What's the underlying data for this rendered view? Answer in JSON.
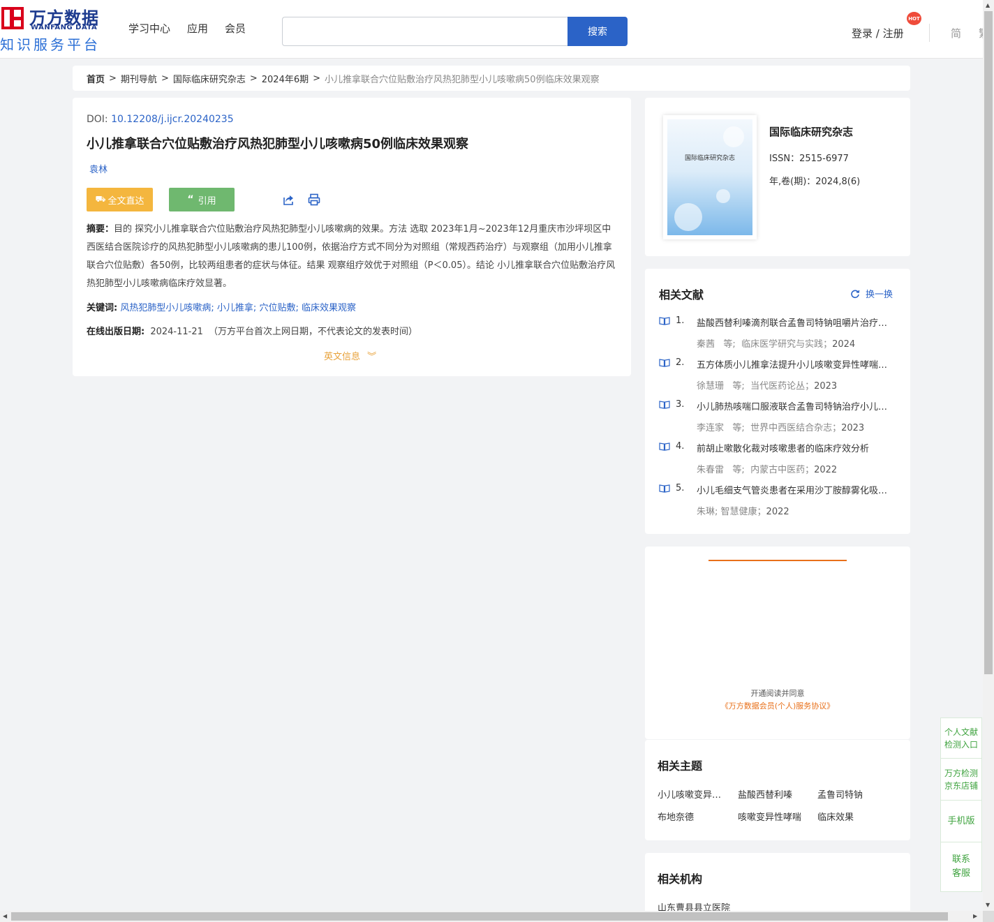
{
  "header": {
    "logo_cn": "万方数据",
    "logo_en": "WANFANG DATA",
    "logo_sub": "知识服务平台",
    "nav": [
      "学习中心",
      "应用",
      "会员"
    ],
    "search_placeholder": "",
    "search_button": "搜索",
    "login": "登录 / 注册",
    "hot_badge": "HOT",
    "lang": "简",
    "lang2": "繁"
  },
  "breadcrumb": {
    "home": "首页",
    "items": [
      "期刊导航",
      "国际临床研究杂志",
      "2024年6期"
    ],
    "current": "小儿推拿联合穴位贴敷治疗风热犯肺型小儿咳嗽病50例临床效果观察",
    "sep": ">"
  },
  "article": {
    "doi_label": "DOI:",
    "doi": "10.12208/j.ijcr.20240235",
    "title": "小儿推拿联合穴位贴敷治疗风热犯肺型小儿咳嗽病50例临床效果观察",
    "author": "袁林",
    "btn_full": "全文直达",
    "btn_cite": "引用",
    "abstract_label": "摘要：",
    "abstract": "目的 探究小儿推拿联合穴位贴敷治疗风热犯肺型小儿咳嗽病的效果。方法 选取 2023年1月~2023年12月重庆市沙坪坝区中西医结合医院诊疗的风热犯肺型小儿咳嗽病的患儿100例，依据治疗方式不同分为对照组（常规西药治疗）与观察组（加用小儿推拿联合穴位贴敷）各50例，比较两组患者的症状与体征。结果 观察组疗效优于对照组（P＜0.05）。结论 小儿推拿联合穴位贴敷治疗风热犯肺型小儿咳嗽病临床疗效显著。",
    "keywords_label": "关键词:",
    "keywords": [
      "风热犯肺型小儿咳嗽病",
      "小儿推拿",
      "穴位贴敷",
      "临床效果观察"
    ],
    "pub_label": "在线出版日期:",
    "pub_date": "2024-11-21",
    "pub_note": "（万方平台首次上网日期，不代表论文的发表时间）",
    "en_info": "英文信息"
  },
  "journal": {
    "cover_title": "国际临床研究杂志",
    "name": "国际临床研究杂志",
    "issn": "ISSN：2515-6977",
    "vol": "年,卷(期)：2024,8(6)"
  },
  "related": {
    "title": "相关文献",
    "refresh": "换一换",
    "items": [
      {
        "num": "1.",
        "title": "盐酸西替利嗪滴剂联合孟鲁司特钠咀嚼片治疗小儿咳嗽变异性哮喘的效果",
        "authors": "秦茜",
        "etc": "等;",
        "source": "临床医学研究与实践；",
        "year": "2024"
      },
      {
        "num": "2.",
        "title": "五方体质小儿推拿法提升小儿咳嗽变异性哮喘疗效的研究",
        "authors": "徐慧珊",
        "etc": "等;",
        "source": "当代医药论丛；",
        "year": "2023"
      },
      {
        "num": "3.",
        "title": "小儿肺热咳喘口服液联合孟鲁司特钠治疗小儿支原体肺炎的效果",
        "authors": "李连家",
        "etc": "等;",
        "source": "世界中西医结合杂志；",
        "year": "2023"
      },
      {
        "num": "4.",
        "title": "前胡止嗽散化裁对咳嗽患者的临床疗效分析",
        "authors": "朱春雷",
        "etc": "等;",
        "source": "内蒙古中医药；",
        "year": "2022"
      },
      {
        "num": "5.",
        "title": "小儿毛细支气管炎患者在采用沙丁胺醇雾化吸入治疗中的效果",
        "authors": "朱琳;",
        "etc": "",
        "source": "智慧健康；",
        "year": "2022"
      }
    ]
  },
  "ad": {
    "text1": "开通阅读并同意",
    "text2": "《万方数据会员(个人)服务协议》"
  },
  "topics": {
    "title": "相关主题",
    "items": [
      "小儿咳嗽变异性哮喘",
      "盐酸西替利嗪",
      "孟鲁司特钠",
      "布地奈德",
      "咳嗽变异性哮喘",
      "临床效果"
    ]
  },
  "orgs": {
    "title": "相关机构",
    "items": [
      "山东曹县县立医院"
    ]
  },
  "side_panel": {
    "items": [
      "个人文献检测入口",
      "万方检测京东店铺",
      "手机版",
      "联系客服"
    ],
    "lines": [
      [
        "个人文献",
        "检测入口"
      ],
      [
        "万方检测",
        "京东店铺"
      ],
      [
        "手机版"
      ],
      [
        "联系",
        "客服"
      ]
    ]
  },
  "colors": {
    "primary": "#2b63c7",
    "full_btn": "#f4b63e",
    "cite_btn": "#6fb86f",
    "accent": "#e8701a",
    "brand_red": "#d9001b"
  }
}
